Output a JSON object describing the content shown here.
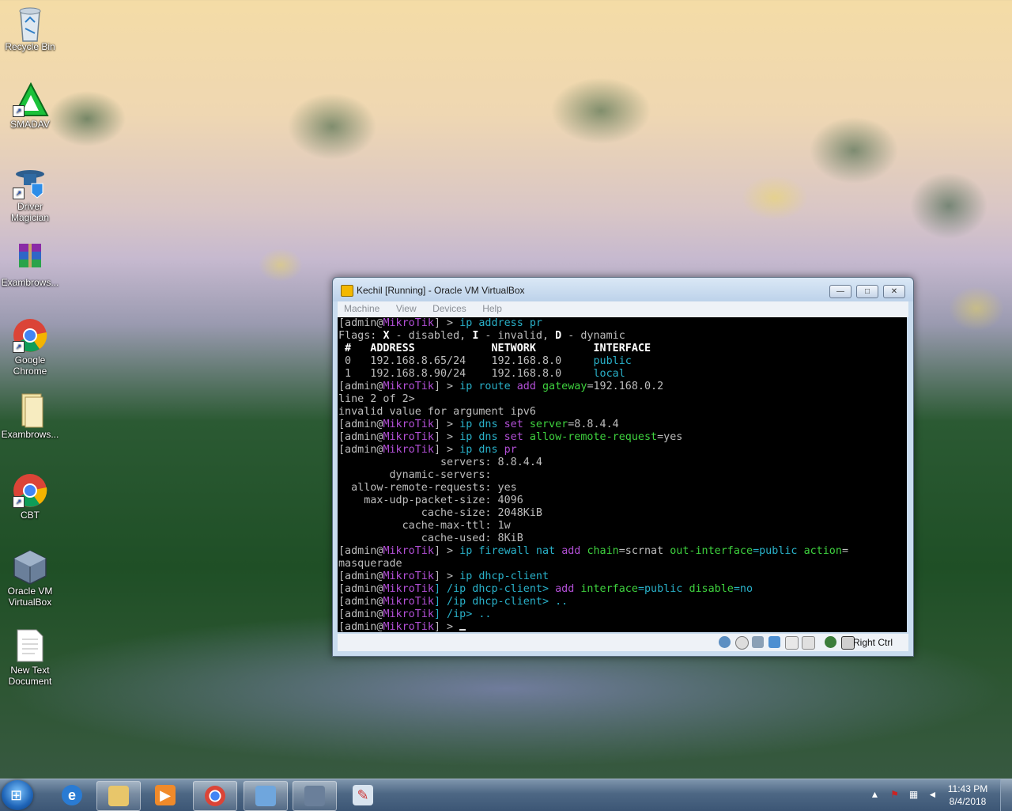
{
  "desktop_icons": [
    {
      "label": "Recycle Bin"
    },
    {
      "label": "SMADAV"
    },
    {
      "label": "Driver Magician"
    },
    {
      "label": "Exambrows..."
    },
    {
      "label": "Google Chrome"
    },
    {
      "label": "Exambrows..."
    },
    {
      "label": "CBT"
    },
    {
      "label": "Oracle VM VirtualBox"
    },
    {
      "label": "New Text Document"
    }
  ],
  "window": {
    "title": "Kechil [Running] - Oracle VM VirtualBox",
    "menu": [
      "Machine",
      "View",
      "Devices",
      "Help"
    ],
    "host_key": "Right Ctrl",
    "minimize": "—",
    "maximize": "□",
    "close": "✕"
  },
  "terminal": {
    "prompt_user": "admin",
    "prompt_host": "MikroTik",
    "lines": [
      [
        "[admin@",
        "MikroTik",
        "] > ",
        "ip address pr"
      ],
      [
        "Flags: ",
        "X",
        " - disabled, ",
        "I",
        " - invalid, ",
        "D",
        " - dynamic"
      ],
      [
        " #   ADDRESS            NETWORK         INTERFACE"
      ],
      [
        " 0   192.168.8.65/24    192.168.8.0     ",
        "public"
      ],
      [
        " 1   192.168.8.90/24    192.168.8.0     ",
        "local"
      ],
      [
        "[admin@",
        "MikroTik",
        "] > ",
        "ip route ",
        "add ",
        "gateway",
        "=192.168.0.2"
      ],
      [
        "line 2 of 2>"
      ],
      [
        "invalid value for argument ipv6"
      ],
      [
        "[admin@",
        "MikroTik",
        "] > ",
        "ip dns ",
        "set ",
        "server",
        "=8.8.4.4"
      ],
      [
        "[admin@",
        "MikroTik",
        "] > ",
        "ip dns ",
        "set ",
        "allow-remote-request",
        "=yes"
      ],
      [
        "[admin@",
        "MikroTik",
        "] > ",
        "ip dns ",
        "pr"
      ],
      [
        "                servers: 8.8.4.4"
      ],
      [
        "        dynamic-servers:"
      ],
      [
        "  allow-remote-requests: yes"
      ],
      [
        "    max-udp-packet-size: 4096"
      ],
      [
        "             cache-size: 2048KiB"
      ],
      [
        "          cache-max-ttl: 1w"
      ],
      [
        "             cache-used: 8KiB"
      ],
      [
        "[admin@",
        "MikroTik",
        "] > ",
        "ip firewall nat ",
        "add ",
        "chain",
        "=scrnat ",
        "out-interface",
        "=public ",
        "action",
        "="
      ],
      [
        "masquerade"
      ],
      [
        "[admin@",
        "MikroTik",
        "] > ",
        "ip dhcp-client"
      ],
      [
        "[admin@",
        "MikroTik",
        "] /ip dhcp-client> ",
        "add ",
        "interface",
        "=public ",
        "disable",
        "=no"
      ],
      [
        "[admin@",
        "MikroTik",
        "] /ip dhcp-client> ",
        ".."
      ],
      [
        "[admin@",
        "MikroTik",
        "] /ip> ",
        ".."
      ],
      [
        "[admin@",
        "MikroTik",
        "] > ",
        ""
      ]
    ]
  },
  "taskbar": {
    "time": "11:43 PM",
    "date": "8/4/2018"
  },
  "colors": {
    "terminal_bg": "#000000",
    "prompt_host": "#b24fd6",
    "command": "#29b0c8",
    "keyword": "#3ed13e"
  }
}
